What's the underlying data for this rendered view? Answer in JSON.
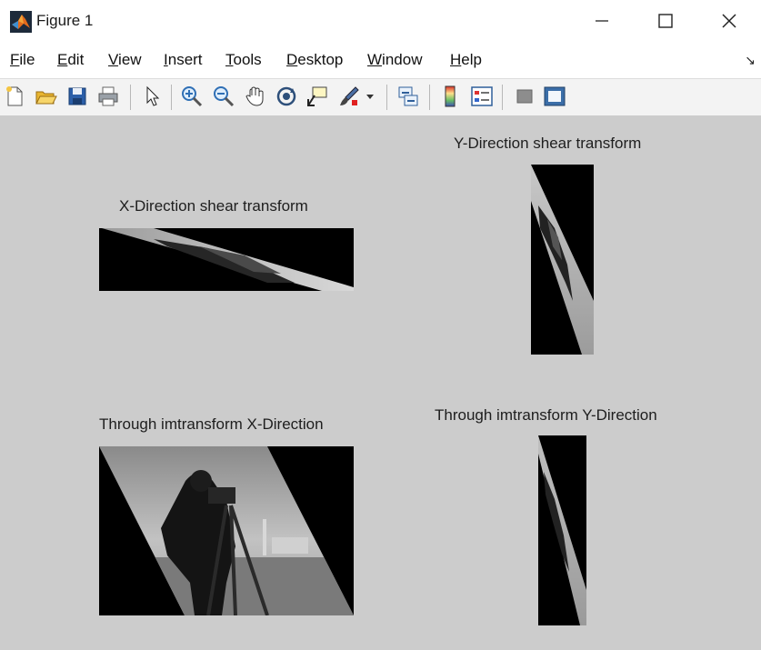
{
  "window": {
    "title": "Figure 1",
    "app_icon": "matlab-logo-icon",
    "controls": [
      "minimize-icon",
      "maximize-icon",
      "close-icon"
    ]
  },
  "menu": {
    "items": [
      {
        "label": "File",
        "mnemonic": "F"
      },
      {
        "label": "Edit",
        "mnemonic": "E"
      },
      {
        "label": "View",
        "mnemonic": "V"
      },
      {
        "label": "Insert",
        "mnemonic": "I"
      },
      {
        "label": "Tools",
        "mnemonic": "T"
      },
      {
        "label": "Desktop",
        "mnemonic": "D"
      },
      {
        "label": "Window",
        "mnemonic": "W"
      },
      {
        "label": "Help",
        "mnemonic": "H"
      }
    ],
    "dock_icon": "dock-arrow-icon"
  },
  "toolbar": {
    "buttons": [
      "new-figure-icon",
      "open-file-icon",
      "save-icon",
      "print-icon",
      "select-arrow-icon",
      "zoom-in-icon",
      "zoom-out-icon",
      "pan-icon",
      "rotate-3d-icon",
      "data-cursor-icon",
      "brush-icon",
      "brush-dropdown-icon",
      "link-plot-icon",
      "colorbar-icon",
      "legend-icon",
      "hide-plot-tools-icon",
      "show-plot-tools-icon"
    ]
  },
  "plots": {
    "x_shear": {
      "title": "X-Direction shear transform"
    },
    "y_shear": {
      "title": "Y-Direction shear transform"
    },
    "imtransform_x": {
      "title": "Through imtransform X-Direction"
    },
    "imtransform_y": {
      "title": "Through imtransform Y-Direction"
    }
  },
  "colors": {
    "canvas": "#cccccc",
    "image_background": "#000000"
  }
}
